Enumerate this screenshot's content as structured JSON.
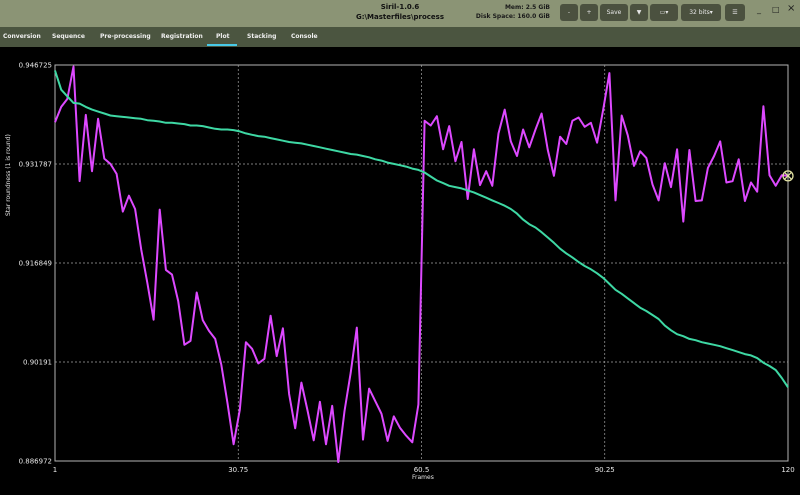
{
  "window": {
    "title": "Siril-1.0.6",
    "path": "G:\\Masterfiles\\process",
    "memory": "Mem: 2.5 GiB",
    "disk_space": "Disk Space: 160.0 GiB",
    "controls": {
      "zoom_out": "-",
      "zoom_in": "+",
      "save": "Save",
      "bits": "32 bits",
      "minimize": "_",
      "maximize": "□",
      "close": "×"
    }
  },
  "tabs": [
    "Conversion",
    "Sequence",
    "Pre-processing",
    "Registration",
    "Plot",
    "Stacking",
    "Console"
  ],
  "selected_tab": "Plot",
  "colors": {
    "series_main": "#dd49ff",
    "series_sorted": "#3ed8a4",
    "titlebar": "#8b9475",
    "tabs": "#4b5540",
    "accent": "#48c9e7",
    "background": "#000000",
    "grid": "#a4a4a4"
  },
  "chart_data": {
    "type": "line",
    "xlabel": "Frames",
    "ylabel": "Star roundness (1 is round)",
    "x_ticks": [
      "1",
      "30.75",
      "60.5",
      "90.25",
      "120"
    ],
    "y_ticks": [
      "0.946725",
      "0.931787",
      "0.916849",
      "0.90191",
      "0.886972"
    ],
    "xlim": [
      1,
      120
    ],
    "ylim": [
      0.886972,
      0.946725
    ],
    "grid": true,
    "legend": "none",
    "series": [
      {
        "values": [
          0.9381,
          0.9404,
          0.9416,
          0.9465,
          0.9292,
          0.9392,
          0.9307,
          0.9386,
          0.9326,
          0.9318,
          0.9303,
          0.9246,
          0.927,
          0.925,
          0.9189,
          0.9138,
          0.9083,
          0.9249,
          0.9158,
          0.9151,
          0.9111,
          0.9045,
          0.9051,
          0.9124,
          0.9082,
          0.9066,
          0.9054,
          0.9015,
          0.8957,
          0.8895,
          0.8947,
          0.9049,
          0.9039,
          0.9017,
          0.9024,
          0.9089,
          0.9028,
          0.907,
          0.8971,
          0.8919,
          0.8988,
          0.8946,
          0.8901,
          0.8959,
          0.8895,
          0.8953,
          0.8868,
          0.8945,
          0.9003,
          0.9071,
          0.8902,
          0.8979,
          0.896,
          0.8941,
          0.89,
          0.8937,
          0.892,
          0.8908,
          0.8898,
          0.8955,
          0.9383,
          0.9376,
          0.939,
          0.934,
          0.9375,
          0.9322,
          0.9351,
          0.9265,
          0.934,
          0.9286,
          0.9307,
          0.9285,
          0.9364,
          0.94,
          0.9352,
          0.933,
          0.937,
          0.9343,
          0.937,
          0.9394,
          0.9339,
          0.93,
          0.9359,
          0.9348,
          0.9383,
          0.9388,
          0.9374,
          0.938,
          0.935,
          0.94,
          0.9455,
          0.9263,
          0.9391,
          0.9361,
          0.9315,
          0.9337,
          0.9327,
          0.9287,
          0.9263,
          0.9319,
          0.9283,
          0.934,
          0.9231,
          0.9339,
          0.9262,
          0.9263,
          0.9312,
          0.933,
          0.9352,
          0.929,
          0.9292,
          0.9325,
          0.9262,
          0.929,
          0.9276,
          0.9405,
          0.9301,
          0.9285,
          0.9301,
          0.93
        ]
      },
      {
        "values": [
          0.9459,
          0.943,
          0.942,
          0.941,
          0.9409,
          0.9404,
          0.94,
          0.9397,
          0.9394,
          0.9391,
          0.939,
          0.9389,
          0.9388,
          0.9387,
          0.9386,
          0.9384,
          0.9383,
          0.9382,
          0.938,
          0.938,
          0.9379,
          0.9378,
          0.9376,
          0.9376,
          0.9375,
          0.9373,
          0.9371,
          0.937,
          0.937,
          0.9369,
          0.9367,
          0.9364,
          0.9362,
          0.936,
          0.9359,
          0.9357,
          0.9355,
          0.9353,
          0.9351,
          0.935,
          0.9349,
          0.9347,
          0.9345,
          0.9343,
          0.9341,
          0.9339,
          0.9337,
          0.9335,
          0.9333,
          0.9332,
          0.933,
          0.9328,
          0.9325,
          0.9323,
          0.932,
          0.9318,
          0.9316,
          0.9314,
          0.9311,
          0.9309,
          0.9305,
          0.9299,
          0.9293,
          0.9289,
          0.9285,
          0.9283,
          0.9281,
          0.9278,
          0.9275,
          0.9271,
          0.9267,
          0.9263,
          0.9259,
          0.9255,
          0.925,
          0.9243,
          0.9234,
          0.9227,
          0.9222,
          0.9215,
          0.9207,
          0.9199,
          0.919,
          0.9183,
          0.9177,
          0.917,
          0.9164,
          0.9159,
          0.9153,
          0.9146,
          0.9137,
          0.9128,
          0.9122,
          0.9115,
          0.9108,
          0.9101,
          0.9096,
          0.909,
          0.9084,
          0.9074,
          0.9067,
          0.9061,
          0.9058,
          0.9054,
          0.9052,
          0.9049,
          0.9047,
          0.9045,
          0.9043,
          0.904,
          0.9037,
          0.9034,
          0.9031,
          0.9029,
          0.9025,
          0.9018,
          0.9013,
          0.9007,
          0.8995,
          0.8981
        ]
      }
    ]
  }
}
